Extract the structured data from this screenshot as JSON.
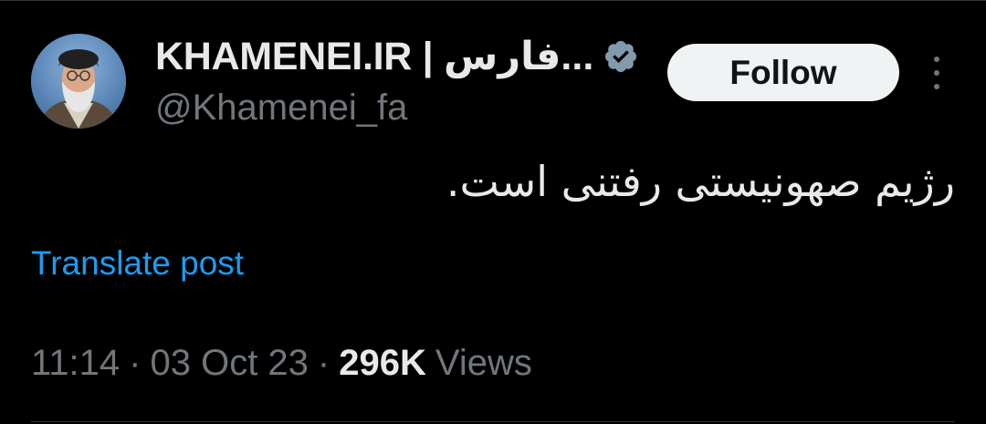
{
  "author": {
    "display_name": "KHAMENEI.IR | فارس...",
    "handle": "@Khamenei_fa",
    "verified_icon": "verified-badge-icon",
    "avatar_icon": "profile-avatar"
  },
  "actions": {
    "follow_label": "Follow",
    "more_icon": "more-options-icon"
  },
  "post": {
    "text": "رژیم صهونیستی رفتنی است.",
    "translate_label": "Translate post"
  },
  "meta": {
    "time": "11:14",
    "separator": "·",
    "date": "03 Oct 23",
    "views_count": "296K",
    "views_label": "Views"
  },
  "colors": {
    "background": "#000000",
    "text_primary": "#e7e9ea",
    "text_secondary": "#71767b",
    "link": "#1d9bf0",
    "follow_bg": "#eff3f4",
    "verified_badge": "#829aab"
  }
}
